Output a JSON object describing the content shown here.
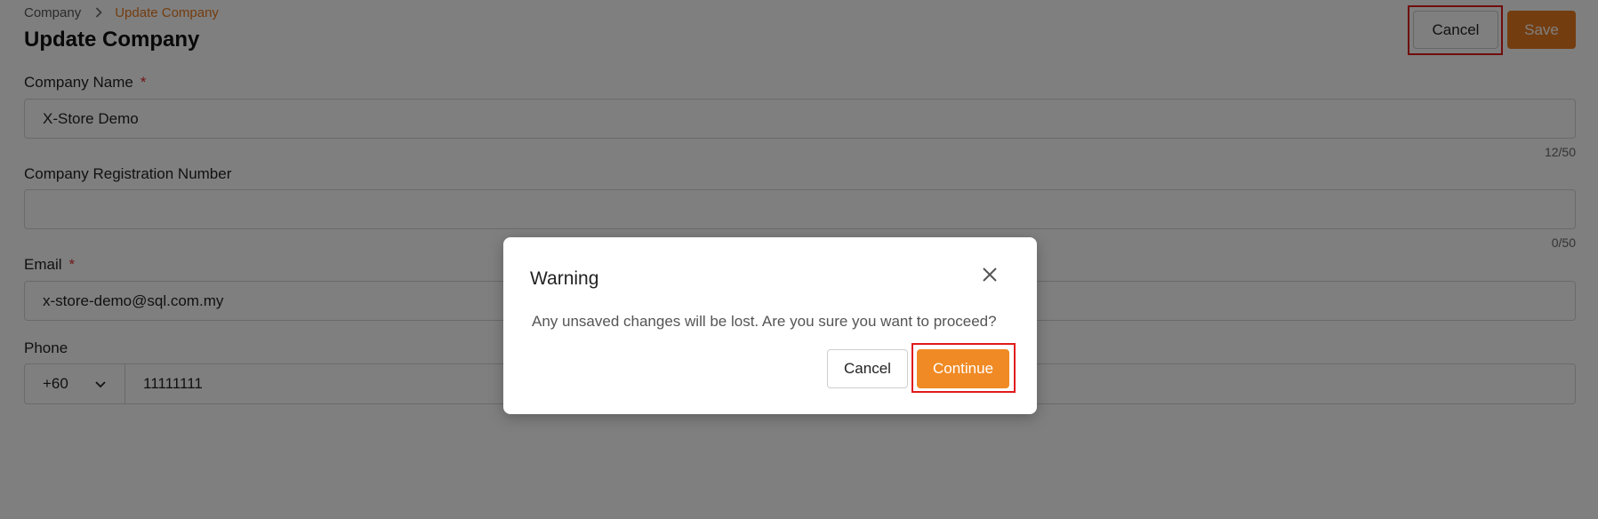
{
  "breadcrumb": {
    "root": "Company",
    "current": "Update Company"
  },
  "header": {
    "title": "Update Company",
    "cancel_label": "Cancel",
    "save_label": "Save"
  },
  "form": {
    "company_name": {
      "label": "Company Name",
      "required_mark": "*",
      "value": "X-Store Demo",
      "counter": "12/50"
    },
    "registration_number": {
      "label": "Company Registration Number",
      "value": "",
      "counter": "0/50"
    },
    "email": {
      "label": "Email",
      "required_mark": "*",
      "value": "x-store-demo@sql.com.my"
    },
    "phone": {
      "label": "Phone",
      "country_code": "+60",
      "value": "11111111"
    }
  },
  "dialog": {
    "title": "Warning",
    "message": "Any unsaved changes will be lost. Are you sure you want to proceed?",
    "cancel_label": "Cancel",
    "continue_label": "Continue"
  },
  "colors": {
    "accent": "#e87a1e",
    "highlight": "#e01b1b",
    "required": "#e0302e"
  },
  "icons": {
    "breadcrumb_separator": "chevron-right-icon",
    "dropdown": "chevron-down-icon",
    "close": "close-icon"
  }
}
